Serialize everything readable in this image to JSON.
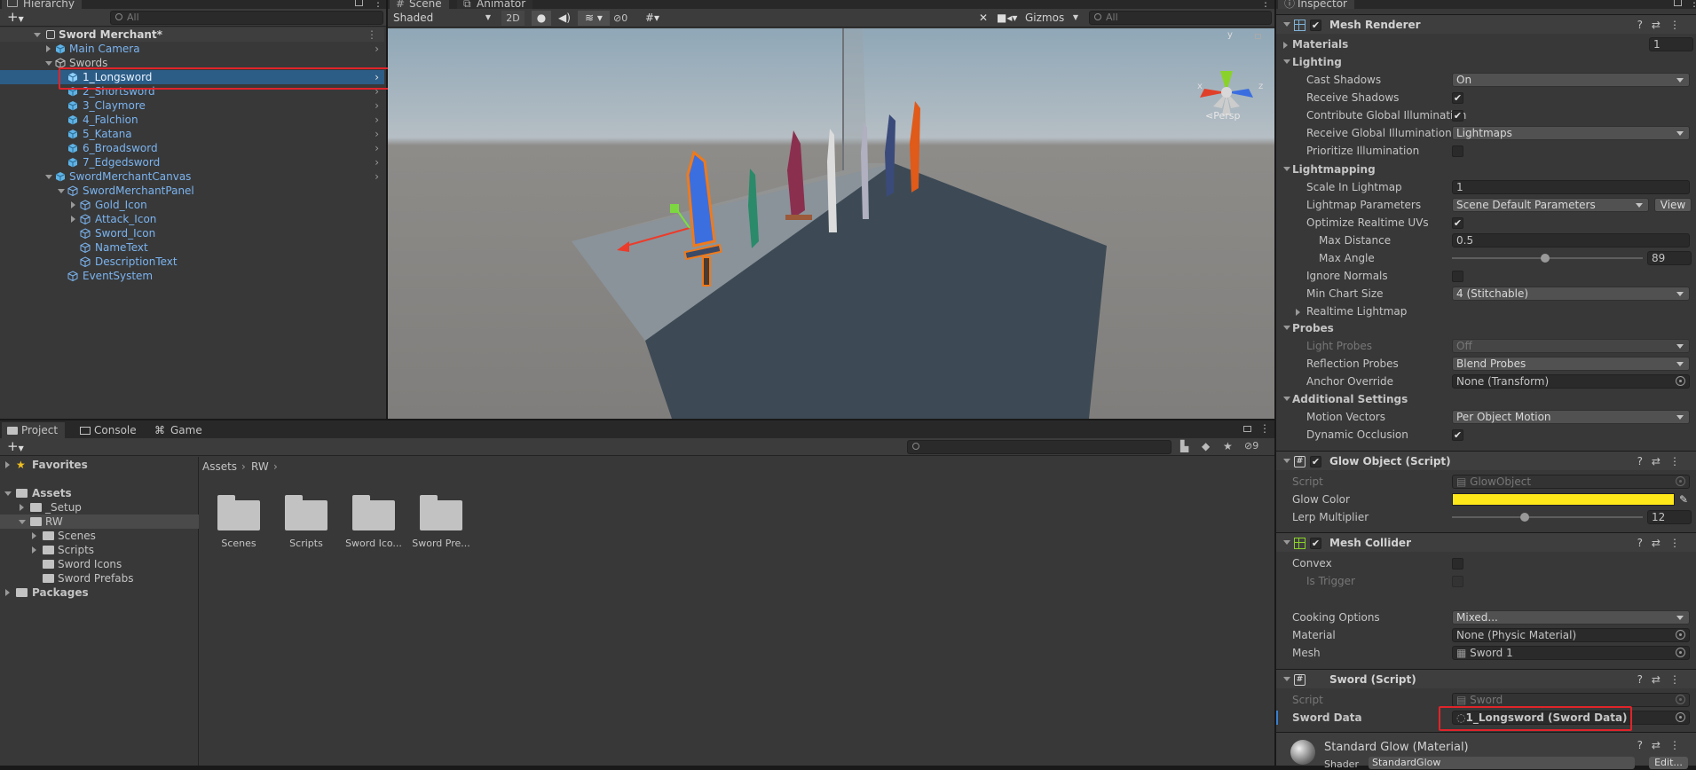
{
  "hierarchy": {
    "tab_label": "Hierarchy",
    "search_placeholder": "All",
    "scene_name": "Sword Merchant*",
    "items": [
      {
        "label": "Main Camera"
      },
      {
        "label": "Swords"
      },
      {
        "label": "1_Longsword"
      },
      {
        "label": "2_Shortsword"
      },
      {
        "label": "3_Claymore"
      },
      {
        "label": "4_Falchion"
      },
      {
        "label": "5_Katana"
      },
      {
        "label": "6_Broadsword"
      },
      {
        "label": "7_Edgedsword"
      },
      {
        "label": "SwordMerchantCanvas"
      },
      {
        "label": "SwordMerchantPanel"
      },
      {
        "label": "Gold_Icon"
      },
      {
        "label": "Attack_Icon"
      },
      {
        "label": "Sword_Icon"
      },
      {
        "label": "NameText"
      },
      {
        "label": "DescriptionText"
      },
      {
        "label": "EventSystem"
      }
    ]
  },
  "scene": {
    "tab_scene": "Scene",
    "tab_animator": "Animator",
    "shading_mode": "Shaded",
    "toggle_2d": "2D",
    "hidden_count": "0",
    "gizmos_label": "Gizmos",
    "search_placeholder": "All",
    "persp_label": "Persp",
    "axis_x": "x",
    "axis_y": "y",
    "axis_z": "z"
  },
  "project": {
    "tab_project": "Project",
    "tab_console": "Console",
    "tab_game": "Game",
    "hidden_count": "9",
    "favorites_label": "Favorites",
    "assets_label": "Assets",
    "tree": [
      {
        "label": "_Setup"
      },
      {
        "label": "RW"
      },
      {
        "label": "Scenes"
      },
      {
        "label": "Scripts"
      },
      {
        "label": "Sword Icons"
      },
      {
        "label": "Sword Prefabs"
      }
    ],
    "packages_label": "Packages",
    "breadcrumb": [
      "Assets",
      "RW"
    ],
    "folders": [
      {
        "label": "Scenes"
      },
      {
        "label": "Scripts"
      },
      {
        "label": "Sword Ico..."
      },
      {
        "label": "Sword Pre..."
      }
    ]
  },
  "inspector": {
    "tab_label": "Inspector",
    "mesh_renderer": {
      "title": "Mesh Renderer",
      "materials_label": "Materials",
      "materials_count": "1",
      "lighting_label": "Lighting",
      "cast_shadows_label": "Cast Shadows",
      "cast_shadows_value": "On",
      "receive_shadows_label": "Receive Shadows",
      "contribute_gi_label": "Contribute Global Illumination",
      "receive_gi_label": "Receive Global Illumination",
      "receive_gi_value": "Lightmaps",
      "prioritize_label": "Prioritize Illumination",
      "lightmapping_label": "Lightmapping",
      "scale_lightmap_label": "Scale In Lightmap",
      "scale_lightmap_value": "1",
      "lightmap_params_label": "Lightmap Parameters",
      "lightmap_params_value": "Scene Default Parameters",
      "view_button": "View",
      "optimize_uvs_label": "Optimize Realtime UVs",
      "max_distance_label": "Max Distance",
      "max_distance_value": "0.5",
      "max_angle_label": "Max Angle",
      "max_angle_value": "89",
      "max_angle_fraction": 0.49,
      "ignore_normals_label": "Ignore Normals",
      "min_chart_label": "Min Chart Size",
      "min_chart_value": "4 (Stitchable)",
      "realtime_lightmap_label": "Realtime Lightmap",
      "probes_label": "Probes",
      "light_probes_label": "Light Probes",
      "light_probes_value": "Off",
      "reflection_probes_label": "Reflection Probes",
      "reflection_probes_value": "Blend Probes",
      "anchor_label": "Anchor Override",
      "anchor_value": "None (Transform)",
      "additional_label": "Additional Settings",
      "motion_vectors_label": "Motion Vectors",
      "motion_vectors_value": "Per Object Motion",
      "dynamic_occlusion_label": "Dynamic Occlusion"
    },
    "glow_object": {
      "title": "Glow Object (Script)",
      "script_label": "Script",
      "script_value": "GlowObject",
      "glow_color_label": "Glow Color",
      "glow_color": "#ffe81a",
      "lerp_label": "Lerp Multiplier",
      "lerp_value": "12",
      "lerp_fraction": 0.38
    },
    "mesh_collider": {
      "title": "Mesh Collider",
      "convex_label": "Convex",
      "is_trigger_label": "Is Trigger",
      "cooking_label": "Cooking Options",
      "cooking_value": "Mixed...",
      "material_label": "Material",
      "material_value": "None (Physic Material)",
      "mesh_label": "Mesh",
      "mesh_value": "Sword 1"
    },
    "sword": {
      "title": "Sword (Script)",
      "script_label": "Script",
      "script_value": "Sword",
      "sword_data_label": "Sword Data",
      "sword_data_value": "1_Longsword (Sword Data)"
    },
    "material": {
      "title": "Standard Glow (Material)",
      "shader_label": "Shader",
      "shader_value": "StandardGlow",
      "edit_button": "Edit..."
    }
  },
  "colors": {
    "selection": "#2c5d87",
    "highlight_box": "#e0242a",
    "prefab_blue": "#7bb4f0"
  }
}
